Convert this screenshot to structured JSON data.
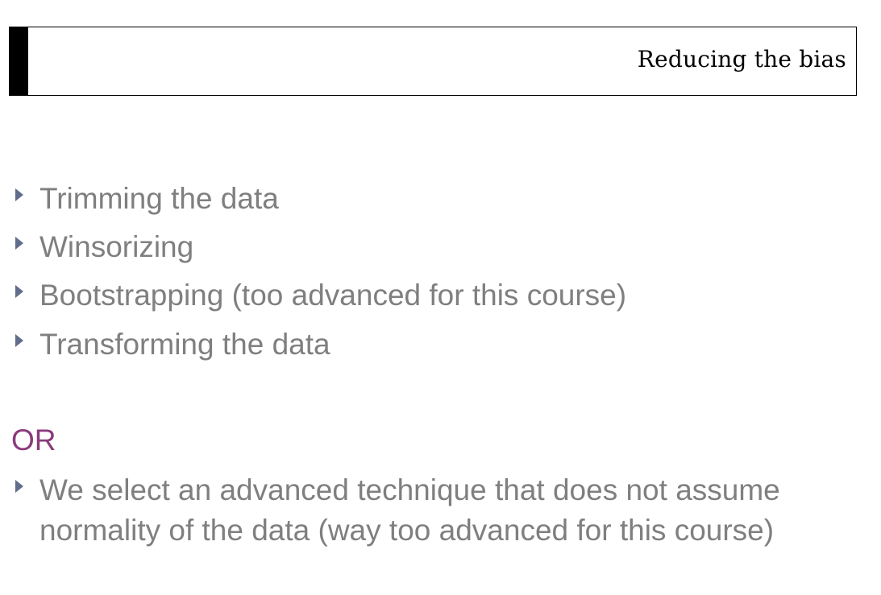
{
  "slide": {
    "title": "Reducing the bias"
  },
  "bullets": [
    {
      "text": "Trimming the data",
      "icon": "triangle-bullet-icon"
    },
    {
      "text": "Winsorizing",
      "icon": "triangle-bullet-icon"
    },
    {
      "text": "Bootstrapping (too advanced for this course)",
      "icon": "triangle-bullet-icon"
    },
    {
      "text": "Transforming the data",
      "icon": "triangle-bullet-icon"
    }
  ],
  "or_label": "OR",
  "alternative_bullet": {
    "line1": "We select an advanced technique that does not assume",
    "line2": "normality of the data (way too advanced for this course)",
    "icon": "triangle-bullet-icon"
  },
  "colors": {
    "bullet_text": "#7f7f7f",
    "bullet_marker": "#5f6e8a",
    "or_label": "#8b3a7c",
    "title_text": "#000000",
    "title_border": "#000000"
  }
}
